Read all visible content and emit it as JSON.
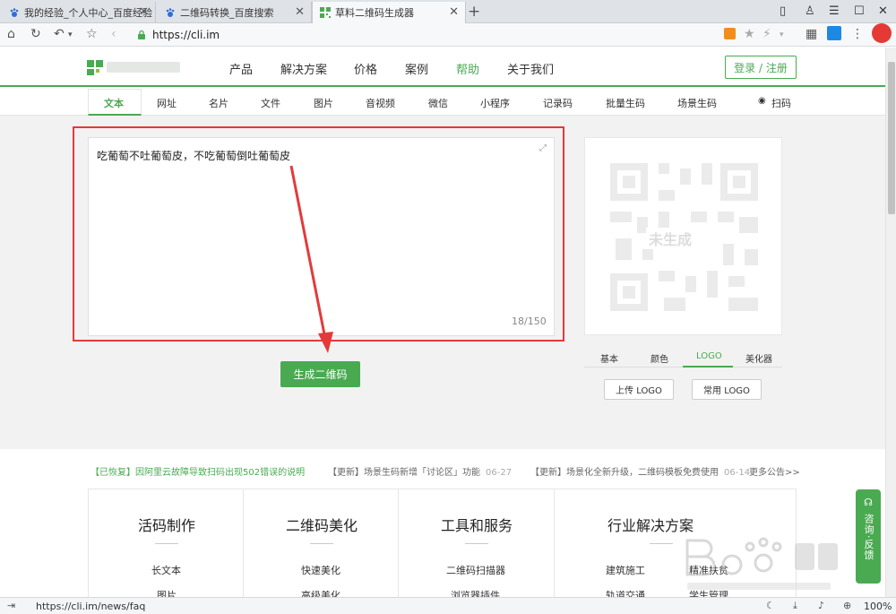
{
  "browser": {
    "tabs": [
      {
        "title": "我的经验_个人中心_百度经验",
        "icon": "baidu-paw-icon"
      },
      {
        "title": "二维码转换_百度搜索",
        "icon": "baidu-paw-icon"
      },
      {
        "title": "草料二维码生成器",
        "icon": "qr-favicon-icon"
      }
    ],
    "new_tab_glyph": "+",
    "url": "https://cli.im",
    "status_url": "https://cli.im/news/faq",
    "zoom": "100%"
  },
  "site": {
    "nav": [
      "产品",
      "解决方案",
      "价格",
      "案例",
      "帮助",
      "关于我们"
    ],
    "login": "登录 / 注册",
    "subtabs": [
      "文本",
      "网址",
      "名片",
      "文件",
      "图片",
      "音视频",
      "微信",
      "小程序",
      "记录码",
      "批量生码",
      "场景生码",
      "扫码"
    ]
  },
  "editor": {
    "text": "吃葡萄不吐葡萄皮，不吃葡萄倒吐葡萄皮",
    "count": "18/150",
    "generate": "生成二维码"
  },
  "qr": {
    "placeholder": "未生成",
    "tabs": [
      "基本",
      "颜色",
      "LOGO",
      "美化器"
    ],
    "upload_logo": "上传 LOGO",
    "common_logo": "常用 LOGO"
  },
  "news": [
    {
      "text": "【已恢复】因阿里云故障导致扫码出现502错误的说明",
      "date": ""
    },
    {
      "text": "【更新】场景生码新增「讨论区」功能",
      "date": "06-27"
    },
    {
      "text": "【更新】场景化全新升级，二维码模板免费使用",
      "date": "06-14"
    },
    {
      "text": "更多公告>>",
      "date": ""
    }
  ],
  "footer": {
    "columns": [
      {
        "title": "活码制作",
        "items": [
          "长文本",
          "图片"
        ]
      },
      {
        "title": "二维码美化",
        "items": [
          "快速美化",
          "高级美化"
        ]
      },
      {
        "title": "工具和服务",
        "items": [
          "二维码扫描器",
          "浏览器插件"
        ]
      },
      {
        "title": "行业解决方案",
        "items": [
          "建筑施工",
          "精准扶贫",
          "轨道交通",
          "学生管理"
        ]
      }
    ],
    "consult": "咨询·反馈"
  },
  "colors": {
    "green": "#4aaa52",
    "red": "#e43a3a"
  }
}
